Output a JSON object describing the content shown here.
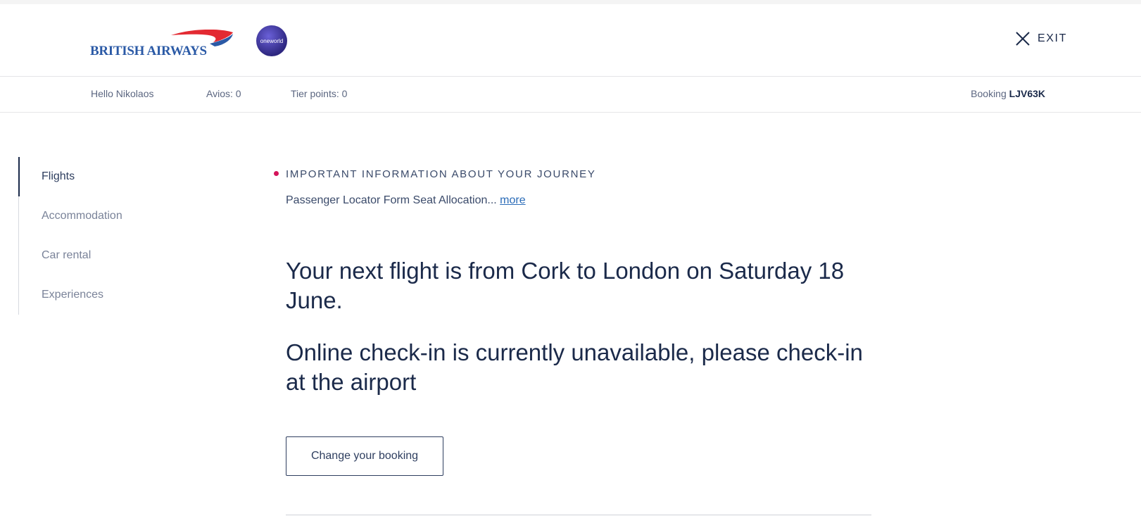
{
  "header": {
    "brand_name": "BRITISH AIRWAYS",
    "alliance_logo_text": "oneworld",
    "exit_label": "EXIT"
  },
  "user_bar": {
    "greeting": "Hello Nikolaos",
    "avios": "Avios: 0",
    "tier_points": "Tier points: 0",
    "booking_label": "Booking",
    "booking_ref": "LJV63K"
  },
  "sidebar": {
    "items": [
      {
        "label": "Flights",
        "active": true
      },
      {
        "label": "Accommodation",
        "active": false
      },
      {
        "label": "Car rental",
        "active": false
      },
      {
        "label": "Experiences",
        "active": false
      }
    ]
  },
  "main": {
    "info_title": "IMPORTANT INFORMATION ABOUT YOUR JOURNEY",
    "info_text": "Passenger Locator Form Seat Allocation...",
    "info_more": "more",
    "next_flight": "Your next flight is from Cork to London on Saturday 18 June.",
    "checkin_notice": "Online check-in is currently unavailable, please check-in at the airport",
    "change_booking_label": "Change your booking"
  },
  "colors": {
    "brand_blue": "#2b5aa6",
    "brand_red": "#e32a32",
    "navy": "#1b2a4a",
    "alert_bullet": "#d4145a",
    "link": "#2b6cb8"
  }
}
